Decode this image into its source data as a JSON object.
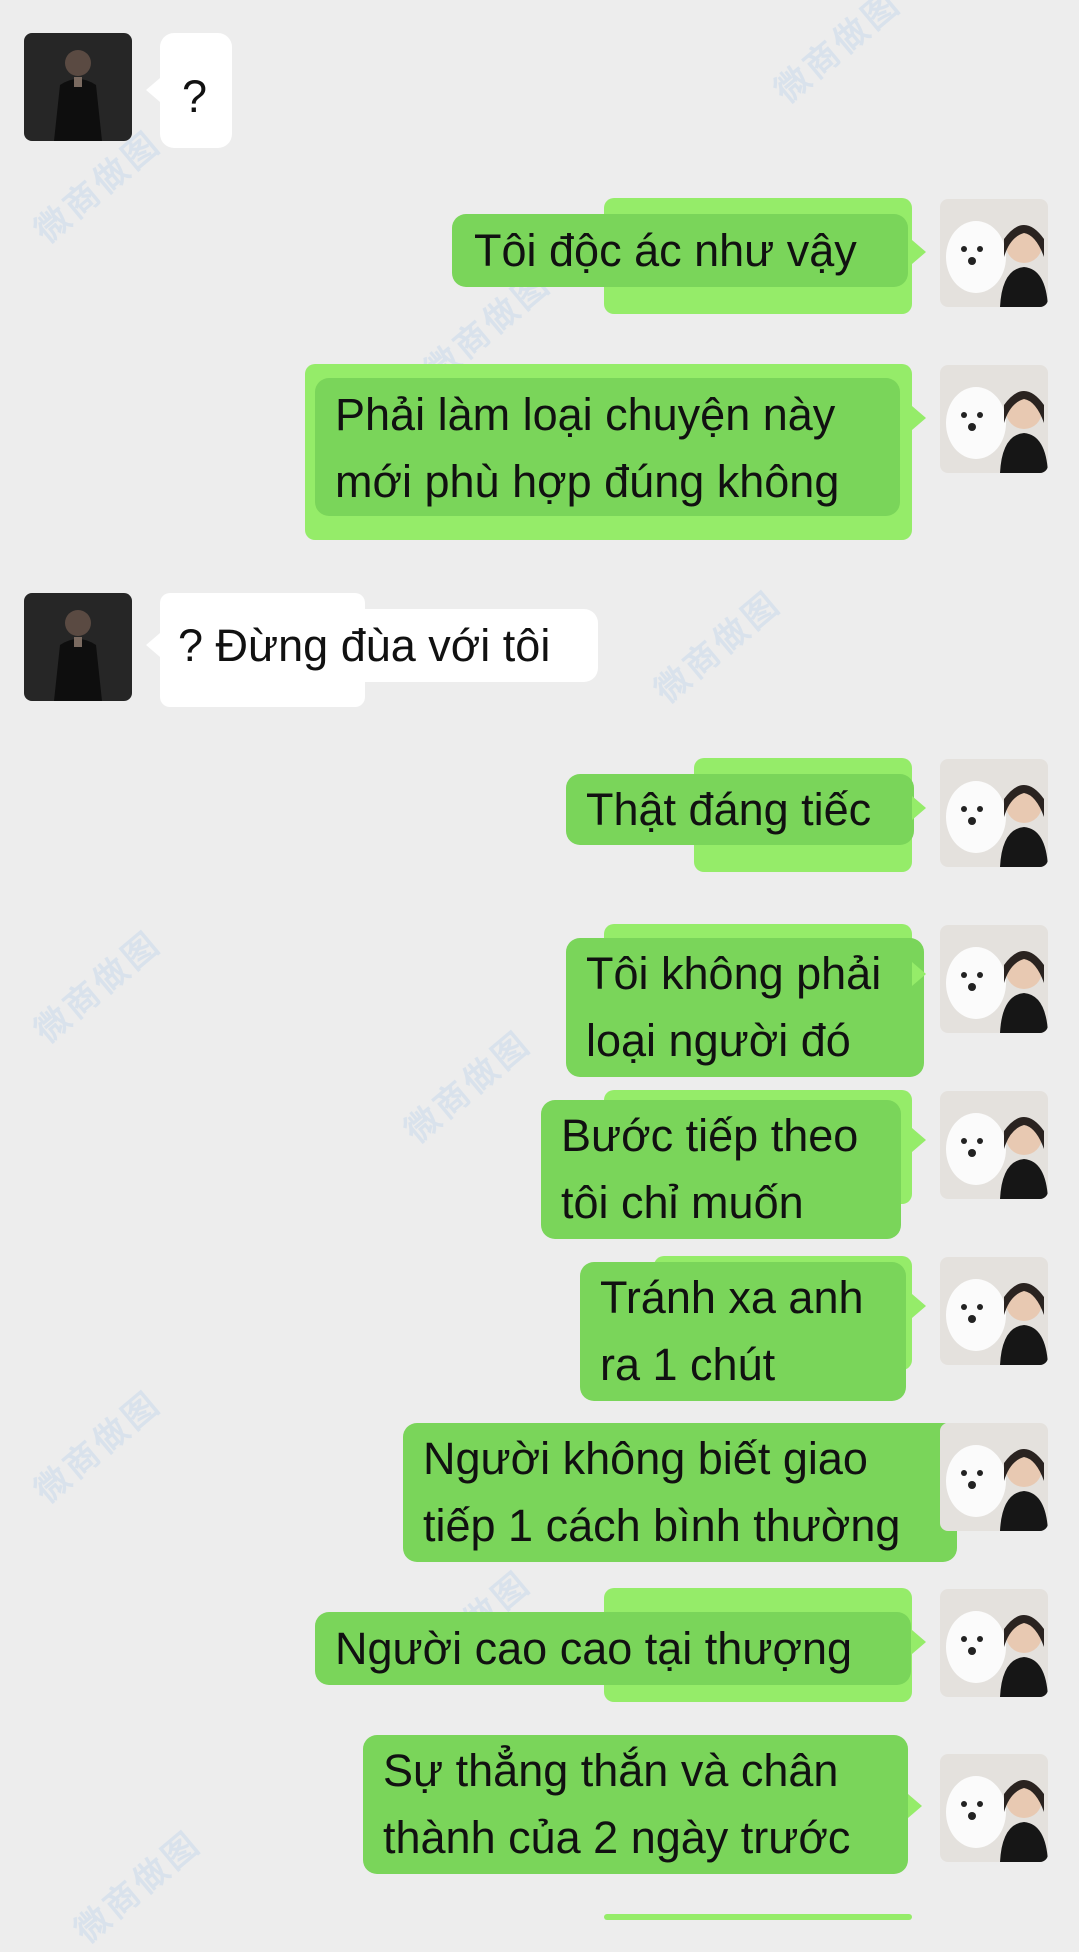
{
  "conversation": {
    "messages": [
      {
        "side": "left",
        "text": "?"
      },
      {
        "side": "right",
        "text": "Tôi độc ác như vậy"
      },
      {
        "side": "right",
        "text": "Phải làm loại chuyện này\nmới phù hợp đúng không"
      },
      {
        "side": "left",
        "text": "? Đừng đùa với tôi"
      },
      {
        "side": "right",
        "text": "Thật đáng tiếc"
      },
      {
        "side": "right",
        "text": "Tôi không phải\nloại người đó"
      },
      {
        "side": "right",
        "text": "Bước tiếp theo\ntôi chỉ muốn"
      },
      {
        "side": "right",
        "text": "Tránh xa anh\nra 1 chút"
      },
      {
        "side": "right",
        "text": "Người không biết giao\ntiếp 1 cách bình thường"
      },
      {
        "side": "right",
        "text": "Người cao cao tại thượng"
      },
      {
        "side": "right",
        "text": "Sự thẳng thắn và chân\nthành của 2 ngày trước"
      }
    ]
  },
  "watermark": {
    "text": "微商做图"
  },
  "colors": {
    "background": "#ededed",
    "outgoing_bubble": "#7ad55a",
    "outgoing_bubble_back": "#95ec69",
    "incoming_bubble": "#ffffff"
  },
  "icons": {
    "contact_avatar": "man-in-black-suit-avatar",
    "self_avatar": "person-with-white-dog-avatar"
  }
}
